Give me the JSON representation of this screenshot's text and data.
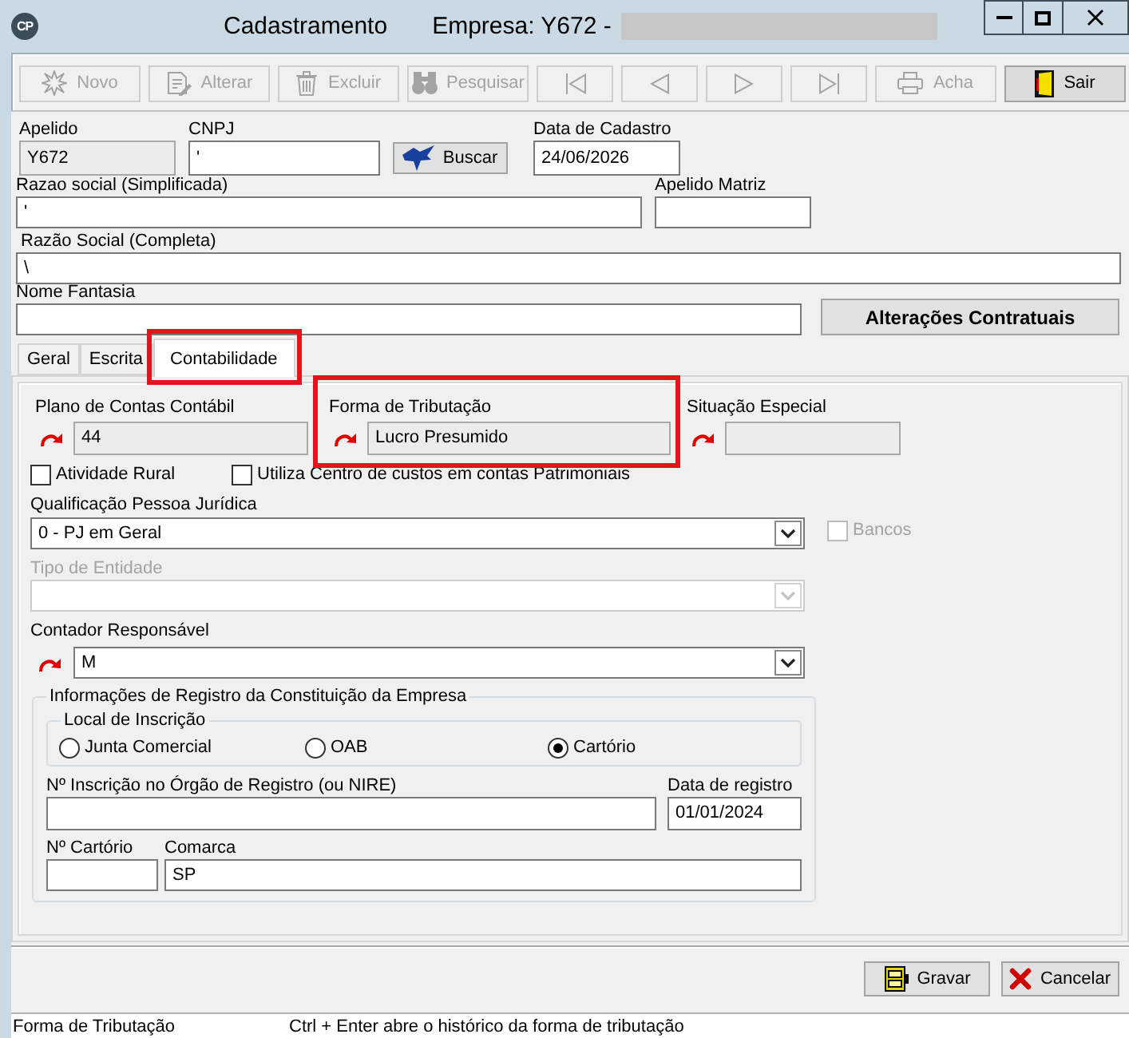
{
  "window": {
    "logo": "CP",
    "title": "Cadastramento",
    "company": "Empresa: Y672 -"
  },
  "toolbar": [
    {
      "kind": "text",
      "label": "Novo",
      "disabled": true
    },
    {
      "kind": "text",
      "label": "Alterar",
      "disabled": true
    },
    {
      "kind": "text",
      "label": "Excluir",
      "disabled": true
    },
    {
      "kind": "text",
      "label": "Pesquisar",
      "disabled": true
    },
    {
      "kind": "nav",
      "disabled": true
    },
    {
      "kind": "nav",
      "disabled": true
    },
    {
      "kind": "nav",
      "disabled": true
    },
    {
      "kind": "nav",
      "disabled": true
    },
    {
      "kind": "text",
      "label": "Acha",
      "disabled": true
    },
    {
      "kind": "text",
      "label": "Sair",
      "disabled": false
    }
  ],
  "header": {
    "apelido": {
      "label": "Apelido",
      "value": "Y672",
      "readonly": true
    },
    "cnpj": {
      "label": "CNPJ",
      "value": "'"
    },
    "buscar_button": "Buscar",
    "data_cadastro": {
      "label": "Data de Cadastro",
      "value": "24/06/2026"
    },
    "razao_simplificada": {
      "label": "Razao social (Simplificada)",
      "value": "'"
    },
    "apelido_matriz": {
      "label": "Apelido Matriz"
    },
    "razao_completa": {
      "label": "Razão Social (Completa)",
      "value": "\\"
    },
    "nome_fantasia": {
      "label": "Nome Fantasia"
    },
    "alteracoes_button": "Alterações Contratuais"
  },
  "tabs": [
    {
      "label": "Geral",
      "selected": false,
      "highlighted": false
    },
    {
      "label": "Escrita",
      "selected": false,
      "highlighted": false
    },
    {
      "label": "Contabilidade",
      "selected": true,
      "highlighted": true
    }
  ],
  "contabilidade": {
    "lookup_fields": [
      {
        "label": "Plano de Contas Contábil",
        "value": "44",
        "readonly": true,
        "highlighted": false
      },
      {
        "label": "Forma de Tributação",
        "value": "Lucro Presumido",
        "readonly": true,
        "highlighted": true
      },
      {
        "label": "Situação Especial",
        "readonly": true,
        "highlighted": false
      }
    ],
    "checkboxes": [
      {
        "label": "Atividade Rural",
        "checked": false
      },
      {
        "label": "Utiliza Centro de custos em contas Patrimoniais",
        "checked": false
      }
    ],
    "qualificacao": {
      "label": "Qualificação Pessoa Jurídica",
      "value": "0 - PJ em Geral",
      "disabled": false
    },
    "bancos": {
      "label": "Bancos",
      "checked": false,
      "disabled": true
    },
    "tipo_entidade": {
      "label": "Tipo de Entidade",
      "disabled": true
    },
    "contador": {
      "label": "Contador Responsável",
      "value": "M",
      "disabled": false
    },
    "registro": {
      "title": "Informações de Registro da Constituição da Empresa",
      "local_title": "Local de Inscrição",
      "local_options": [
        {
          "label": "Junta Comercial",
          "selected": false
        },
        {
          "label": "OAB",
          "selected": false
        },
        {
          "label": "Cartório",
          "selected": true
        }
      ],
      "nire": {
        "label": "Nº Inscrição no Órgão de Registro (ou NIRE)"
      },
      "data_registro": {
        "label": "Data de registro",
        "value": "01/01/2024"
      },
      "cartorio": {
        "label": "Nº Cartório"
      },
      "comarca": {
        "label": "Comarca",
        "value": "SP"
      }
    }
  },
  "footer_buttons": [
    "Gravar",
    "Cancelar"
  ],
  "status_bar": {
    "field": "Forma de Tributação",
    "hint": "Ctrl + Enter abre o histórico da forma de tributação"
  }
}
